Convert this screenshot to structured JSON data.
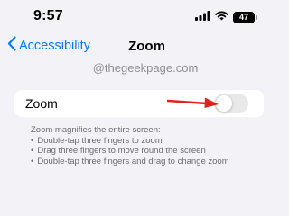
{
  "status_bar": {
    "time": "9:57",
    "battery_level": "47",
    "icons": [
      "signal-icon",
      "wifi-icon",
      "battery-icon"
    ]
  },
  "nav": {
    "back_label": "Accessibility",
    "title": "Zoom"
  },
  "watermark": "@thegeekpage.com",
  "zoom_setting": {
    "label": "Zoom",
    "enabled": false
  },
  "footer": {
    "heading": "Zoom magnifies the entire screen:",
    "items": [
      "Double-tap three fingers to zoom",
      "Drag three fingers to move round the screen",
      "Double-tap three fingers and drag to change zoom"
    ]
  },
  "colors": {
    "accent": "#0a7aff",
    "annotation_arrow": "#e3231b",
    "toggle_off": "#e9e9ea",
    "background": "#f2f2f7"
  }
}
